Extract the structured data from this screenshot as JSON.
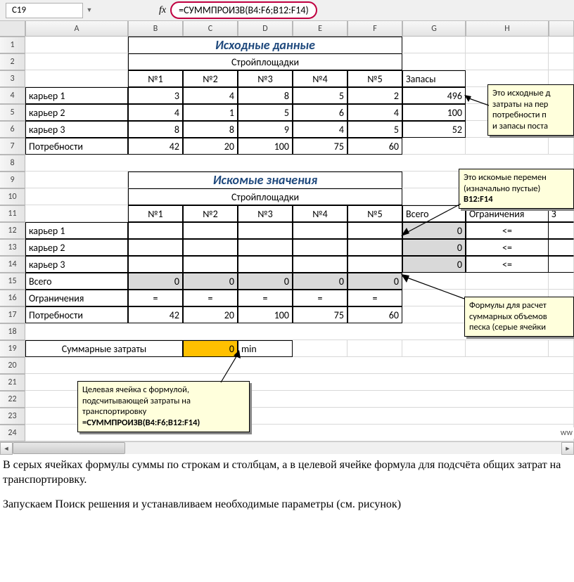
{
  "formula_bar": {
    "cell_ref": "C19",
    "fx_label": "fx",
    "formula": "=СУММПРОИЗВ(B4:F6;B12:F14)"
  },
  "col_headers": [
    "A",
    "B",
    "C",
    "D",
    "E",
    "F",
    "G",
    "H"
  ],
  "row_headers": [
    "1",
    "2",
    "3",
    "4",
    "5",
    "6",
    "7",
    "8",
    "9",
    "10",
    "11",
    "12",
    "13",
    "14",
    "15",
    "16",
    "17",
    "18",
    "19",
    "20",
    "21",
    "22",
    "23",
    "24"
  ],
  "sheet": {
    "title1": "Исходные данные",
    "site_label1": "Стройплощадки",
    "col_nums": [
      "№1",
      "№2",
      "№3",
      "№4",
      "№5"
    ],
    "stock_label": "Запасы",
    "rows1": [
      {
        "name": "карьер 1",
        "vals": [
          "3",
          "4",
          "8",
          "5",
          "2"
        ],
        "stock": "496"
      },
      {
        "name": "карьер 2",
        "vals": [
          "4",
          "1",
          "5",
          "6",
          "4"
        ],
        "stock": "100"
      },
      {
        "name": "карьер 3",
        "vals": [
          "8",
          "8",
          "9",
          "4",
          "5"
        ],
        "stock": "52"
      }
    ],
    "needs_label": "Потребности",
    "needs": [
      "42",
      "20",
      "100",
      "75",
      "60"
    ],
    "title2": "Искомые значения",
    "site_label2": "Стройплощадки",
    "total_label": "Всего",
    "constraint_label": "Ограничения",
    "rows2": [
      {
        "name": "карьер 1",
        "vals": [
          "",
          "",
          "",
          "",
          ""
        ],
        "total": "0",
        "op": "<="
      },
      {
        "name": "карьер 2",
        "vals": [
          "",
          "",
          "",
          "",
          ""
        ],
        "total": "0",
        "op": "<="
      },
      {
        "name": "карьер 3",
        "vals": [
          "",
          "",
          "",
          "",
          ""
        ],
        "total": "0",
        "op": "<="
      }
    ],
    "col_totals": [
      "0",
      "0",
      "0",
      "0",
      "0"
    ],
    "eq": "=",
    "needs2": [
      "42",
      "20",
      "100",
      "75",
      "60"
    ],
    "sum_cost_label": "Суммарные затраты",
    "sum_cost_val": "0",
    "min_label": "min"
  },
  "callouts": {
    "c1_l1": "Это исходные д",
    "c1_l2": "затраты на пер",
    "c1_l3": "потребности п",
    "c1_l4": "и запасы поста",
    "c2_l1": "Это искомые перемен",
    "c2_l2": "(изначально пустые)",
    "c2_l3": "B12:F14",
    "c3_l1": "Формулы для расчет",
    "c3_l2": "суммарных объемов",
    "c3_l3": "песка (серые ячейки",
    "c4_l1": "Целевая ячейка с формулой,",
    "c4_l2": "подсчитывающей затраты на",
    "c4_l3": "транспортировку",
    "c4_l4": "=СУММПРОИЗВ(B4:F6;B12:F14)"
  },
  "body": {
    "p1": "В серых ячейках формулы суммы по строкам и столбцам, а в целевой ячейке формула для подсчёта общих затрат на транспортировку.",
    "p2": "Запускаем Поиск решения и устанавливаем необходимые параметры (см. рисунок)"
  },
  "wm": "ww"
}
